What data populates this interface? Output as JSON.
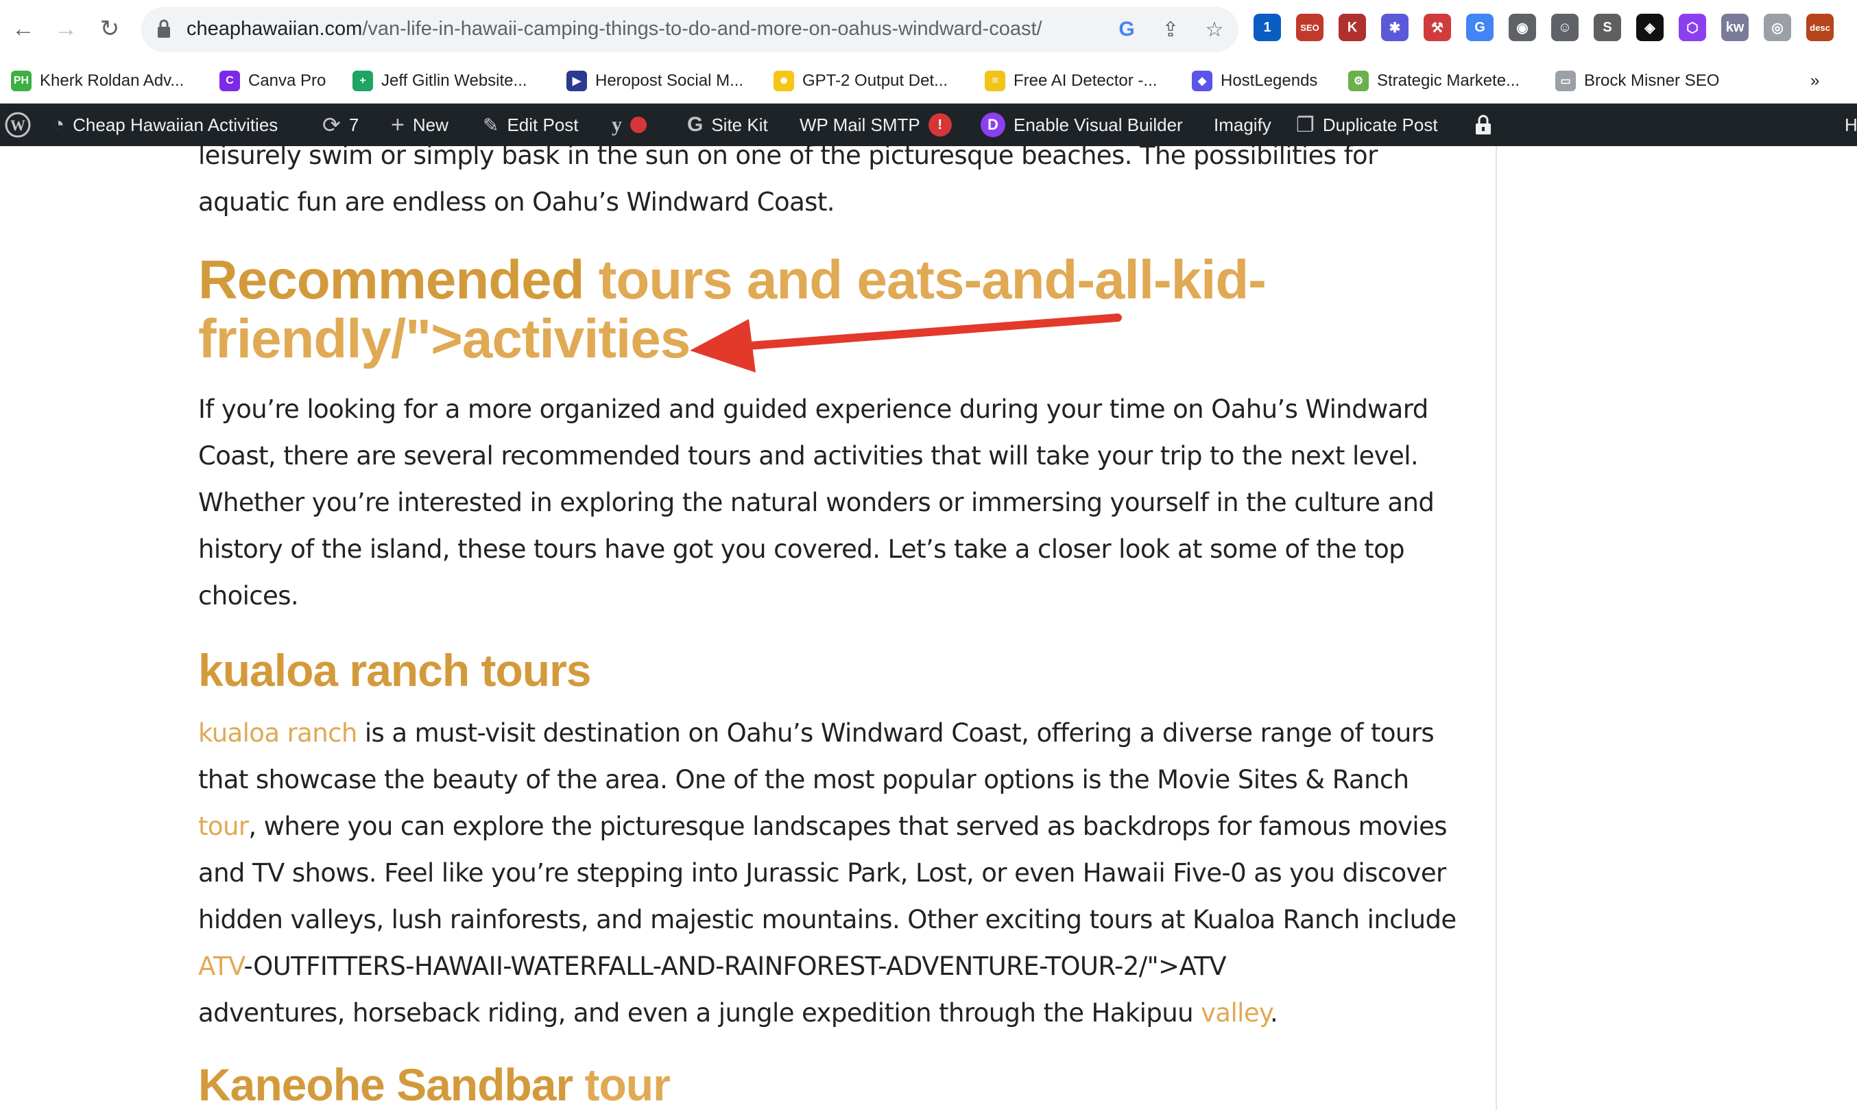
{
  "browser": {
    "url_host": "cheaphawaiian.com",
    "url_path": "/van-life-in-hawaii-camping-things-to-do-and-more-on-oahus-windward-coast/",
    "extensions": [
      {
        "name": "1password-icon",
        "label": "1",
        "color": "#0a5dc2"
      },
      {
        "name": "seo-extension-icon",
        "label": "SEO",
        "color": "#c0392b"
      },
      {
        "name": "k-extension-icon",
        "label": "K",
        "color": "#b03030"
      },
      {
        "name": "snowflake-extension-icon",
        "label": "✱",
        "color": "#5a5ad8"
      },
      {
        "name": "red-tool-extension-icon",
        "label": "⚒",
        "color": "#d23b3b"
      },
      {
        "name": "google-translate-icon",
        "label": "G",
        "color": "#4285f4"
      },
      {
        "name": "location-extension-icon",
        "label": "◉",
        "color": "#5f6368"
      },
      {
        "name": "ghost-extension-icon",
        "label": "☺",
        "color": "#5f6368"
      },
      {
        "name": "s-extension-icon",
        "label": "S",
        "color": "#5f5f5f"
      },
      {
        "name": "chatgpt-extension-icon",
        "label": "◈",
        "color": "#111111"
      },
      {
        "name": "hex-extension-icon",
        "label": "⬡",
        "color": "#8c3ff0"
      },
      {
        "name": "keyword-extension-icon",
        "label": "kw",
        "color": "#7a7a9a"
      },
      {
        "name": "globe-extension-icon",
        "label": "◎",
        "color": "#9aa0a6"
      },
      {
        "name": "desc-extension-icon",
        "label": "desc",
        "color": "#b5451b"
      }
    ]
  },
  "bookmarks": [
    {
      "label": "Kherk Roldan Adv...",
      "fav": "PH",
      "color": "#3cb043"
    },
    {
      "label": "Canva Pro",
      "fav": "C",
      "color": "#7d2ae8"
    },
    {
      "label": "Jeff Gitlin Website...",
      "fav": "+",
      "color": "#1fa463"
    },
    {
      "label": "Heropost Social M...",
      "fav": "▶",
      "color": "#2b3a8f"
    },
    {
      "label": "GPT-2 Output Det...",
      "fav": "☻",
      "color": "#f5c518"
    },
    {
      "label": "Free AI Detector -...",
      "fav": "≡",
      "color": "#f0c419"
    },
    {
      "label": "HostLegends",
      "fav": "◆",
      "color": "#5a55e8"
    },
    {
      "label": "Strategic Markete...",
      "fav": "⚙",
      "color": "#6ab04c"
    },
    {
      "label": "Brock Misner SEO",
      "fav": "▭",
      "color": "#9aa0a6"
    }
  ],
  "bookmarks_overflow": "»",
  "adminbar": {
    "site_name": "Cheap Hawaiian Activities",
    "updates_count": "7",
    "new_label": "New",
    "edit_post_label": "Edit Post",
    "site_kit_label": "Site Kit",
    "wp_mail_label": "WP Mail SMTP",
    "wp_mail_badge": "!",
    "visual_builder_label": "Enable Visual Builder",
    "imagify_label": "Imagify",
    "duplicate_label": "Duplicate Post",
    "right_cut_label": "H"
  },
  "article": {
    "intro_line1": "leisurely swim or simply bask in the sun on one of the picturesque beaches. The possibilities for",
    "intro_line2": "aquatic fun are endless on Oahu’s Windward Coast.",
    "h_recommended_part1": "Recommended ",
    "h_recommended_link": "tours and eats-and-all-kid-",
    "h_recommended_line2": "friendly/\">activities",
    "p_recommended": [
      "If you’re looking for a more organized and guided experience during your time on Oahu’s Windward",
      "Coast, there are several recommended tours and activities that will take your trip to the next level.",
      "Whether you’re interested in exploring the natural wonders or immersing yourself in the culture and",
      "history of the island, these tours have got you covered. Let’s take a closer look at some of the top",
      "choices."
    ],
    "h_kualoa": "kualoa ranch tours",
    "kualoa_link": "kualoa ranch",
    "kualoa_line1_rest": " is a must-visit destination on Oahu’s Windward Coast, offering a diverse range of tours",
    "kualoa_line2": "that showcase the beauty of the area. One of the most popular options is the Movie Sites & Ranch",
    "kualoa_line3_link": "tour",
    "kualoa_line3_rest": ", where you can explore the picturesque landscapes that served as backdrops for famous movies",
    "kualoa_line4": "and TV shows. Feel like you’re stepping into Jurassic Park, Lost, or even Hawaii Five-0 as you discover",
    "kualoa_line5": "hidden valleys, lush rainforests, and majestic mountains. Other exciting tours at Kualoa Ranch include",
    "kualoa_line6_link": "ATV",
    "kualoa_line6_rest": "-OUTFITTERS-HAWAII-WATERFALL-AND-RAINFOREST-ADVENTURE-TOUR-2/\">ATV",
    "kualoa_line7_start": "adventures, horseback riding, and even a jungle expedition through the Hakipuu ",
    "kualoa_line7_link": "valley",
    "kualoa_line7_end": ".",
    "h_sandbar_part1": "Kaneohe Sandbar ",
    "h_sandbar_link": "tour"
  },
  "colors": {
    "heading": "#d39a3c",
    "link": "#e0a954",
    "arrow": "#e2392b",
    "admin_bar": "#1d2327"
  }
}
